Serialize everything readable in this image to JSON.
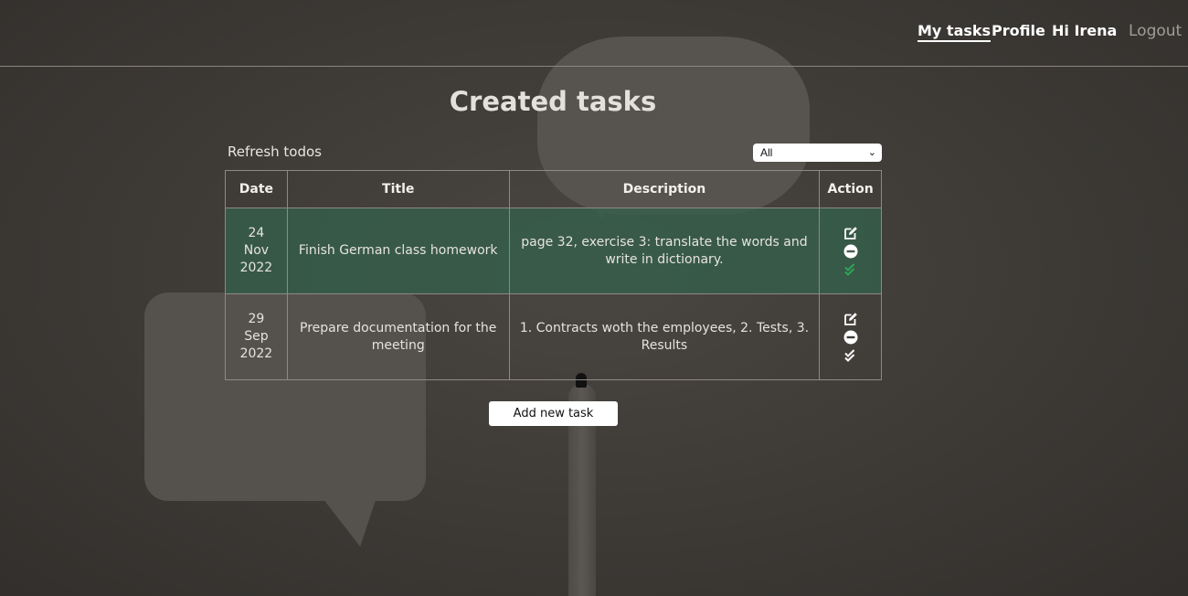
{
  "nav": {
    "my_tasks": "My tasks",
    "profile": "Profile",
    "greeting": "Hi Irena",
    "logout": "Logout"
  },
  "main": {
    "title": "Created tasks",
    "refresh_label": "Refresh todos",
    "filter_selected": "All",
    "add_button_label": "Add new task"
  },
  "table": {
    "headers": [
      "Date",
      "Title",
      "Description",
      "Action"
    ],
    "rows": [
      {
        "day": "24",
        "month": "Nov",
        "year": "2022",
        "title": "Finish German class homework",
        "description": "page 32, exercise 3: translate the words and write in dictionary.",
        "completed": true
      },
      {
        "day": "29",
        "month": "Sep",
        "year": "2022",
        "title": "Prepare documentation for the meeting",
        "description": "1. Contracts woth the employees, 2. Tests, 3. Results",
        "completed": false
      }
    ]
  },
  "icons": {
    "edit": "edit-icon",
    "delete": "remove-circle-icon",
    "complete": "double-check-icon"
  },
  "colors": {
    "completed_row": "#34604a",
    "complete_check_done": "#2fa35a",
    "complete_check_pending": "#ffffff"
  }
}
